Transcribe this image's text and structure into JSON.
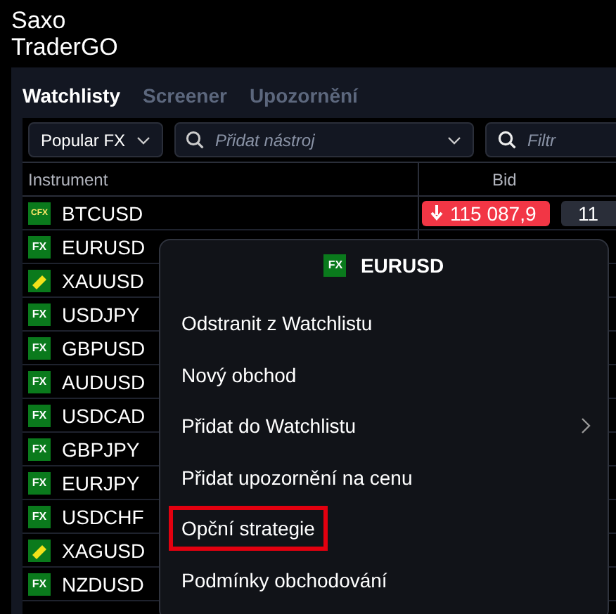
{
  "app_title": [
    "Saxo",
    "TraderGO"
  ],
  "tabs": [
    {
      "label": "Watchlisty",
      "selected": true
    },
    {
      "label": "Screener",
      "selected": false
    },
    {
      "label": "Upozornění",
      "selected": false
    }
  ],
  "list_select": {
    "value": "Popular FX"
  },
  "add_field": {
    "placeholder": "Přidat nástroj"
  },
  "filter_field": {
    "placeholder": "Filtr"
  },
  "table": {
    "columns": [
      "Instrument",
      "Bid"
    ],
    "rows": [
      {
        "kind": "cfx",
        "badge": "CFX",
        "name": "BTCUSD",
        "bid": "115 087,9",
        "falling": true,
        "column_3": "11"
      },
      {
        "kind": "fx",
        "badge": "FX",
        "name": "EURUSD"
      },
      {
        "kind": "metal",
        "name": "XAUUSD"
      },
      {
        "kind": "fx",
        "badge": "FX",
        "name": "USDJPY"
      },
      {
        "kind": "fx",
        "badge": "FX",
        "name": "GBPUSD"
      },
      {
        "kind": "fx",
        "badge": "FX",
        "name": "AUDUSD"
      },
      {
        "kind": "fx",
        "badge": "FX",
        "name": "USDCAD"
      },
      {
        "kind": "fx",
        "badge": "FX",
        "name": "GBPJPY"
      },
      {
        "kind": "fx",
        "badge": "FX",
        "name": "EURJPY"
      },
      {
        "kind": "fx",
        "badge": "FX",
        "name": "USDCHF"
      },
      {
        "kind": "metal",
        "name": "XAGUSD"
      },
      {
        "kind": "fx",
        "badge": "FX",
        "name": "NZDUSD"
      }
    ]
  },
  "context_menu": {
    "badge": "FX",
    "title": "EURUSD",
    "items": [
      {
        "label": "Odstranit z Watchlistu",
        "submenu": false,
        "highlighted": false
      },
      {
        "label": "Nový obchod",
        "submenu": false,
        "highlighted": false
      },
      {
        "label": "Přidat do Watchlistu",
        "submenu": true,
        "highlighted": false
      },
      {
        "label": "Přidat upozornění na cenu",
        "submenu": false,
        "highlighted": false
      },
      {
        "label": "Opční strategie",
        "submenu": false,
        "highlighted": true
      },
      {
        "label": "Podmínky obchodování",
        "submenu": false,
        "highlighted": false
      }
    ]
  }
}
